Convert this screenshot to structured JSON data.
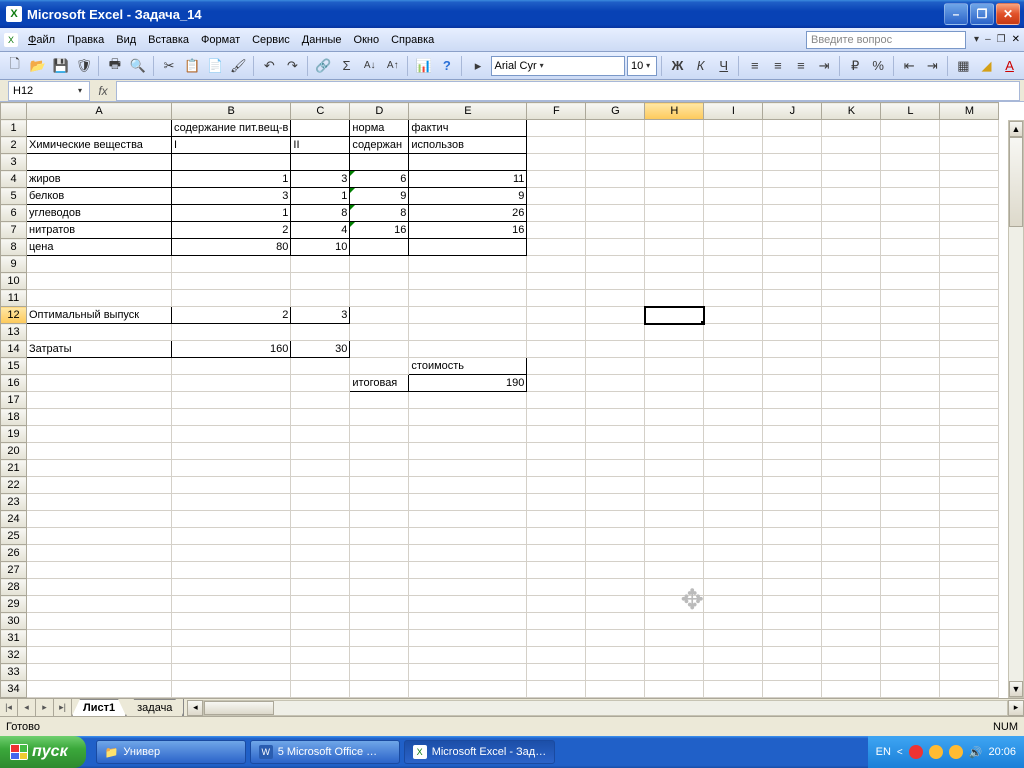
{
  "title": "Microsoft Excel - Задача_14",
  "menus": [
    "Файл",
    "Правка",
    "Вид",
    "Вставка",
    "Формат",
    "Сервис",
    "Данные",
    "Окно",
    "Справка"
  ],
  "question_placeholder": "Введите вопрос",
  "font": {
    "name": "Arial Cyr",
    "size": "10"
  },
  "namebox": "H12",
  "columns": [
    "A",
    "B",
    "C",
    "D",
    "E",
    "F",
    "G",
    "H",
    "I",
    "J",
    "K",
    "L",
    "M"
  ],
  "selected": {
    "col": "H",
    "row": 12
  },
  "cells": {
    "1": {
      "B": "содержание пит.вещ-в",
      "D": "норма",
      "E": "фактич"
    },
    "2": {
      "A": "Химические вещества",
      "B": "I",
      "C": "II",
      "D": "содержан",
      "E": "использов"
    },
    "4": {
      "A": "жиров",
      "B": "1",
      "C": "3",
      "D": "6",
      "E": "11"
    },
    "5": {
      "A": "белков",
      "B": "3",
      "C": "1",
      "D": "9",
      "E": "9"
    },
    "6": {
      "A": "углеводов",
      "B": "1",
      "C": "8",
      "D": "8",
      "E": "26"
    },
    "7": {
      "A": "нитратов",
      "B": "2",
      "C": "4",
      "D": "16",
      "E": "16"
    },
    "8": {
      "A": "цена",
      "B": "80",
      "C": "10"
    },
    "12": {
      "A": "Оптимальный выпуск",
      "B": "2",
      "C": "3"
    },
    "14": {
      "A": "Затраты",
      "B": "160",
      "C": "30"
    },
    "15": {
      "E": "стоимость"
    },
    "16": {
      "D": "итоговая",
      "E": "190"
    }
  },
  "sheets": [
    "Лист1",
    "задача"
  ],
  "active_sheet": 0,
  "status": "Готово",
  "status_right": "NUM",
  "taskbar": {
    "start": "пуск",
    "items": [
      {
        "icon": "folder",
        "label": "Универ"
      },
      {
        "icon": "word",
        "label": "5 Microsoft Office …"
      },
      {
        "icon": "excel",
        "label": "Microsoft Excel - Зад…",
        "active": true
      }
    ],
    "lang": "EN",
    "clock": "20:06"
  }
}
